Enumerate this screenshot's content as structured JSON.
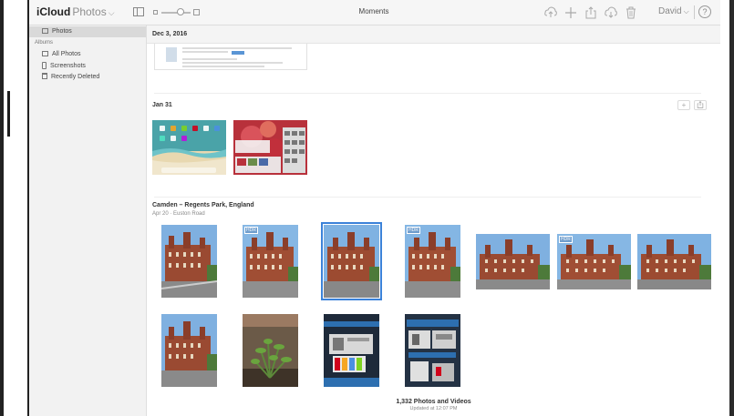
{
  "toolbar": {
    "brand": "iCloud",
    "app": "Photos",
    "title": "Moments",
    "user": "David",
    "help": "?",
    "icons": [
      "upload-icon",
      "add-icon",
      "share-icon",
      "download-icon",
      "trash-icon"
    ]
  },
  "sidebar": {
    "photos_label": "Photos",
    "albums_heading": "Albums",
    "items": [
      {
        "label": "All Photos",
        "icon": "album-icon"
      },
      {
        "label": "Screenshots",
        "icon": "phone-icon"
      },
      {
        "label": "Recently Deleted",
        "icon": "trash-icon"
      }
    ]
  },
  "moments": [
    {
      "title": "Dec 3, 2016"
    },
    {
      "title": "Jan 31",
      "add_icon": "+"
    },
    {
      "title": "Camden – Regents Park, England",
      "subtitle": "Apr 20 · Euston Road"
    }
  ],
  "photo_badges": {
    "hdr": "HDR"
  },
  "footer": {
    "count": "1,332 Photos and Videos",
    "updated": "Updated at 12:07 PM"
  },
  "colors": {
    "accent": "#3b82d9",
    "sidebar_bg": "#f2f2f2",
    "toolbar_bg": "#f6f6f6"
  }
}
